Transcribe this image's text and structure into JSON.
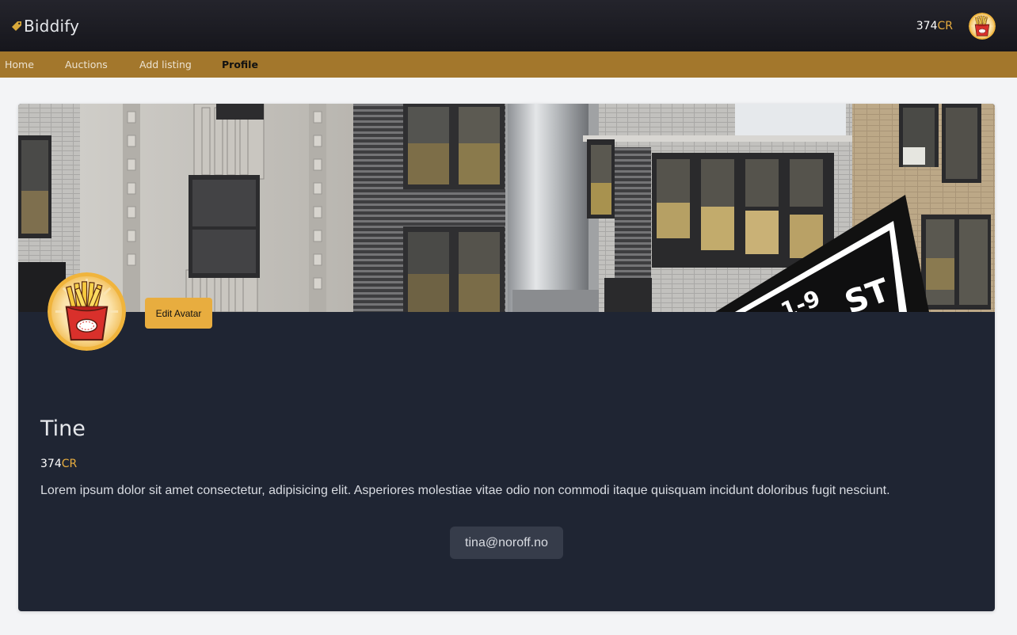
{
  "header": {
    "brand": "Biddify",
    "credits_amount": "374",
    "credits_unit": "CR"
  },
  "nav": {
    "items": [
      {
        "label": "Home",
        "active": false
      },
      {
        "label": "Auctions",
        "active": false
      },
      {
        "label": "Add listing",
        "active": false
      },
      {
        "label": "Profile",
        "active": true
      }
    ]
  },
  "profile": {
    "name": "Tine",
    "credits_amount": "374",
    "credits_unit": "CR",
    "bio": "Lorem ipsum dolor sit amet consectetur, adipisicing elit. Asperiores molestiae vitae odio non commodi itaque quisquam incidunt doloribus fugit nesciunt.",
    "email": "tina@noroff.no",
    "edit_avatar_label": "Edit Avatar",
    "avatar_icon": "french-fries-icon",
    "banner_image": "city-building-street-sign-photo"
  },
  "colors": {
    "accent": "#e8ad3f",
    "nav_bg": "#a3772c",
    "header_bg": "#1c1c22",
    "card_bg": "#1f2533",
    "page_bg": "#f3f4f6"
  }
}
